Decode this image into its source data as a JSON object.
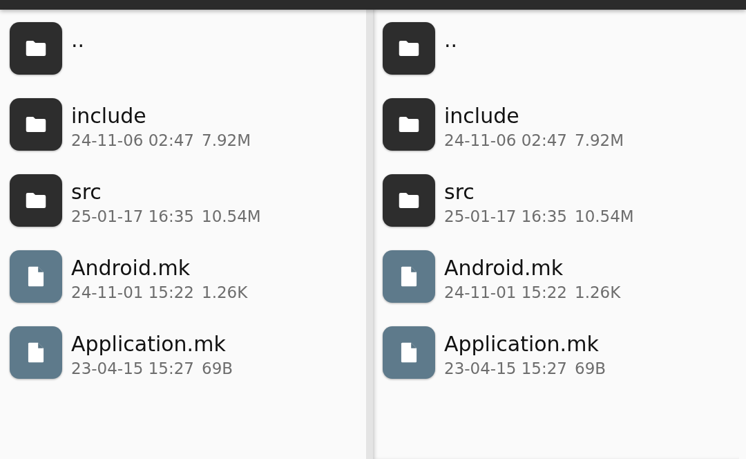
{
  "panes": [
    {
      "items": [
        {
          "kind": "folder",
          "name": ".."
        },
        {
          "kind": "folder",
          "name": "include",
          "date": "24-11-06 02:47",
          "size": "7.92M"
        },
        {
          "kind": "folder",
          "name": "src",
          "date": "25-01-17 16:35",
          "size": "10.54M"
        },
        {
          "kind": "file",
          "name": "Android.mk",
          "date": "24-11-01 15:22",
          "size": "1.26K"
        },
        {
          "kind": "file",
          "name": "Application.mk",
          "date": "23-04-15 15:27",
          "size": "69B"
        }
      ]
    },
    {
      "items": [
        {
          "kind": "folder",
          "name": ".."
        },
        {
          "kind": "folder",
          "name": "include",
          "date": "24-11-06 02:47",
          "size": "7.92M"
        },
        {
          "kind": "folder",
          "name": "src",
          "date": "25-01-17 16:35",
          "size": "10.54M"
        },
        {
          "kind": "file",
          "name": "Android.mk",
          "date": "24-11-01 15:22",
          "size": "1.26K"
        },
        {
          "kind": "file",
          "name": "Application.mk",
          "date": "23-04-15 15:27",
          "size": "69B"
        }
      ]
    }
  ]
}
